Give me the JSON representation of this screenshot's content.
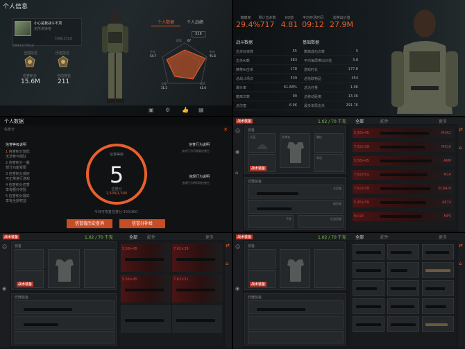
{
  "q1": {
    "title": "个人信息",
    "player_name": "小心是我战斗不顶",
    "player_sub": "无所谓读者",
    "player_id": "5086125135",
    "uid": "5086124765(2)",
    "rank1_label": "当前段位",
    "rank2_label": "历史段位",
    "value1_label": "信誉积分",
    "value1": "15.6M",
    "value2_label": "当前排名",
    "value2": "211",
    "tab_personal": "个人数据",
    "tab_record": "个人战绩",
    "season": "S16",
    "radar_top_label": "搜索",
    "radar_top_value": "67",
    "radar_tl_label": "生存",
    "radar_tl_value": "54.7",
    "radar_tr_label": "射击",
    "radar_tr_value": "91.6",
    "radar_bl_value": "31.5",
    "radar_br_value": "41.6",
    "radar_bl_label": "支援",
    "radar_br_label": "战术"
  },
  "q2": {
    "stats": [
      {
        "label": "撤离率",
        "value": "29.4%"
      },
      {
        "label": "累计击杀数",
        "value": "717"
      },
      {
        "label": "KD值",
        "value": "4.81"
      },
      {
        "label": "平均存活时间",
        "value": "09:12"
      },
      {
        "label": "总带出价值",
        "value": "27.9M"
      }
    ],
    "header_left": "战斗数据",
    "header_right": "基础数据",
    "left_rows": [
      {
        "label": "击杀玩家数",
        "value": "55"
      },
      {
        "label": "击杀AI数",
        "value": "583"
      },
      {
        "label": "精英AI击杀",
        "value": "178"
      },
      {
        "label": "总战斗场次",
        "value": "539"
      },
      {
        "label": "爆头率",
        "value": "61.68%"
      },
      {
        "label": "撤离次数",
        "value": "99"
      },
      {
        "label": "总伤害",
        "value": "6.9K"
      }
    ],
    "right_rows": [
      {
        "label": "撤离成功次数",
        "value": "5"
      },
      {
        "label": "平均每局带出价值",
        "value": "3.8"
      },
      {
        "label": "游戏时长",
        "value": "177.8"
      },
      {
        "label": "总拾取物品",
        "value": "454"
      },
      {
        "label": "总治疗量",
        "value": "1.9K"
      },
      {
        "label": "总移动距离",
        "value": "13.3K"
      },
      {
        "label": "最多单局击杀",
        "value": "291.7K"
      }
    ]
  },
  "q3": {
    "title": "个人数据",
    "sub": "信誉分",
    "left_title": "信誉等级说明",
    "levels": [
      {
        "n": "1",
        "a": "信誉积分较低",
        "b": "无法参与组队"
      },
      {
        "n": "2",
        "a": "信誉积分一般",
        "b": "部分功能受限"
      },
      {
        "n": "3",
        "a": "信誉积分良好",
        "b": "可正常进行游戏"
      },
      {
        "n": "4",
        "a": "信誉积分优秀",
        "b": "享有额外奖励"
      },
      {
        "n": "5",
        "a": "信誉积分极好",
        "b": "享有全部权益"
      }
    ],
    "ring_top": "信誉等级",
    "ring_value": "5",
    "ring_score_label": "信誉分",
    "ring_score": "1,500/1,500",
    "today": "今日可恢复信誉分 300/300",
    "right_title1": "信誉行为说明",
    "right_text1": "良好行为可恢复信誉分",
    "right_title2": "违规行为说明",
    "right_text2": "违规行为将扣除信誉分",
    "btn_history": "信誉值历史查询",
    "btn_detail": "信誉分补给"
  },
  "inv": {
    "money": "1.02 / 70 千克",
    "tag": "战术装备",
    "equip_label": "装备",
    "helmet": "头盔",
    "armor": "防弹衣",
    "chest": "胸挂",
    "backpack": "背包",
    "weapon_label": "武器装备",
    "primary": "主武器",
    "secondary": "副武器",
    "pistol": "手枪",
    "melee": "近战武器",
    "tab_all": "全部",
    "tab_ammo": "配件",
    "tab_more": "更多",
    "calibers": [
      "5.56×45",
      "7.62×39",
      "5.56×45",
      "7.62×51",
      "7.62×39",
      "5.45×39",
      "9×19"
    ],
    "guns_right": [
      "M4A1",
      "MK16",
      "AKM",
      "M14",
      "SCAR-H",
      "AK74",
      "MP5"
    ]
  }
}
